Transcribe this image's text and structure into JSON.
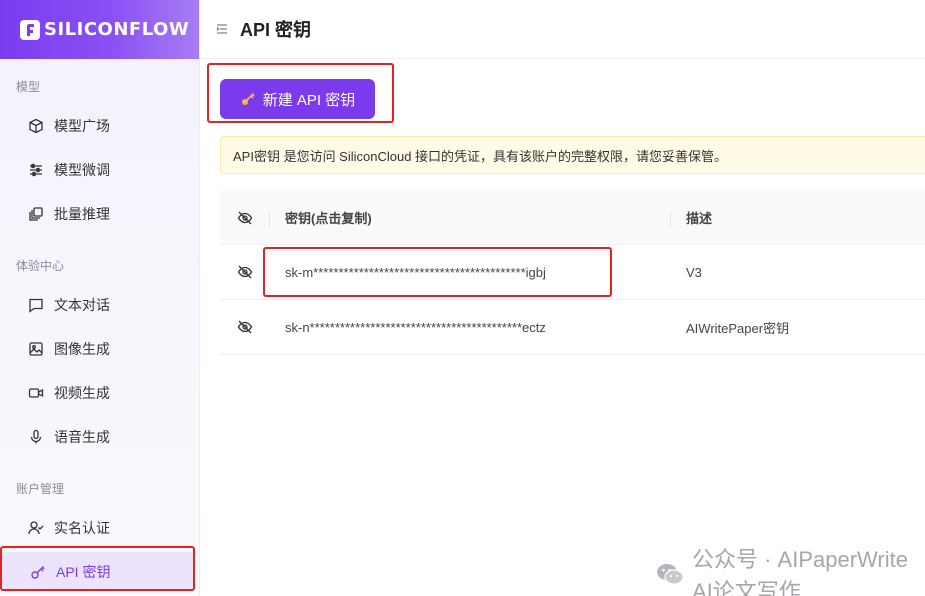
{
  "brand": {
    "logo_text": "SILICONFLOW"
  },
  "header": {
    "title": "API 密钥"
  },
  "sidebar": {
    "sections": [
      {
        "label": "模型"
      },
      {
        "label": "体验中心"
      },
      {
        "label": "账户管理"
      }
    ],
    "items": [
      {
        "label": "模型广场",
        "icon": "cube-icon"
      },
      {
        "label": "模型微调",
        "icon": "sliders-icon"
      },
      {
        "label": "批量推理",
        "icon": "layers-icon"
      },
      {
        "label": "文本对话",
        "icon": "chat-icon"
      },
      {
        "label": "图像生成",
        "icon": "image-icon"
      },
      {
        "label": "视频生成",
        "icon": "video-icon"
      },
      {
        "label": "语音生成",
        "icon": "microphone-icon"
      },
      {
        "label": "实名认证",
        "icon": "user-check-icon"
      },
      {
        "label": "API 密钥",
        "icon": "key-icon",
        "active": true
      }
    ]
  },
  "main": {
    "new_key_button": "新建 API 密钥",
    "notice": "API密钥 是您访问 SiliconCloud 接口的凭证，具有该账户的完整权限，请您妥善保管。",
    "table": {
      "columns": [
        "密钥(点击复制)",
        "描述"
      ],
      "rows": [
        {
          "key": "sk-m******************************************igbj",
          "description": "V3"
        },
        {
          "key": "sk-n******************************************ectz",
          "description": "AIWritePaper密钥"
        }
      ]
    }
  },
  "watermark": {
    "text": "公众号 · AIPaperWrite AI论文写作"
  },
  "colors": {
    "accent": "#7c3aed",
    "highlight_red": "#e52222",
    "notice_bg": "#fffbe6"
  }
}
